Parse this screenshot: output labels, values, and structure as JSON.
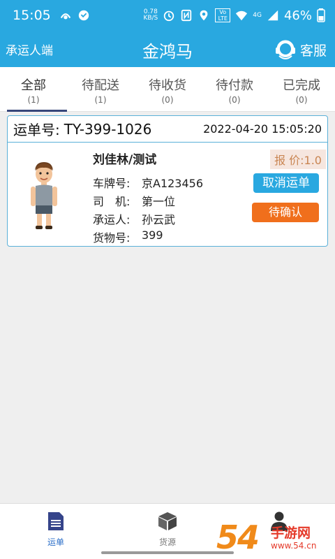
{
  "status_bar": {
    "time": "15:05",
    "net_speed_value": "0.78",
    "net_speed_unit": "KB/S",
    "volte": "Vo LTE",
    "network": "4G",
    "battery": "46%"
  },
  "header": {
    "role": "承运人端",
    "title": "金鸿马",
    "service_label": "客服"
  },
  "tabs": [
    {
      "label": "全部",
      "count": "(1)",
      "active": true
    },
    {
      "label": "待配送",
      "count": "(1)"
    },
    {
      "label": "待收货",
      "count": "(0)"
    },
    {
      "label": "待付款",
      "count": "(0)"
    },
    {
      "label": "已完成",
      "count": "(0)"
    }
  ],
  "order": {
    "waybill_label": "运单号:",
    "waybill_no": "TY-399-1026",
    "datetime": "2022-04-20 15:05:20",
    "name": "刘佳林/测试",
    "price_label": "报 价:1.0",
    "fields": [
      {
        "key": "车牌号:",
        "value": "京A123456"
      },
      {
        "key": "司　机:",
        "value": "第一位"
      },
      {
        "key": "承运人:",
        "value": "孙云武"
      },
      {
        "key": "货物号:",
        "value": "399"
      }
    ],
    "cancel_label": "取消运单",
    "status_label": "待确认"
  },
  "bottom_nav": [
    {
      "label": "运单",
      "icon": "document-icon",
      "active": true
    },
    {
      "label": "货源",
      "icon": "box-icon"
    },
    {
      "label": "",
      "icon": "person-icon"
    }
  ],
  "watermark": {
    "big": "54",
    "small": "手游网",
    "url": "www.54.cn"
  },
  "colors": {
    "primary": "#29a8e0",
    "accent_orange": "#f06f1c",
    "tab_indicator": "#37467a",
    "price_text": "#c98552"
  }
}
